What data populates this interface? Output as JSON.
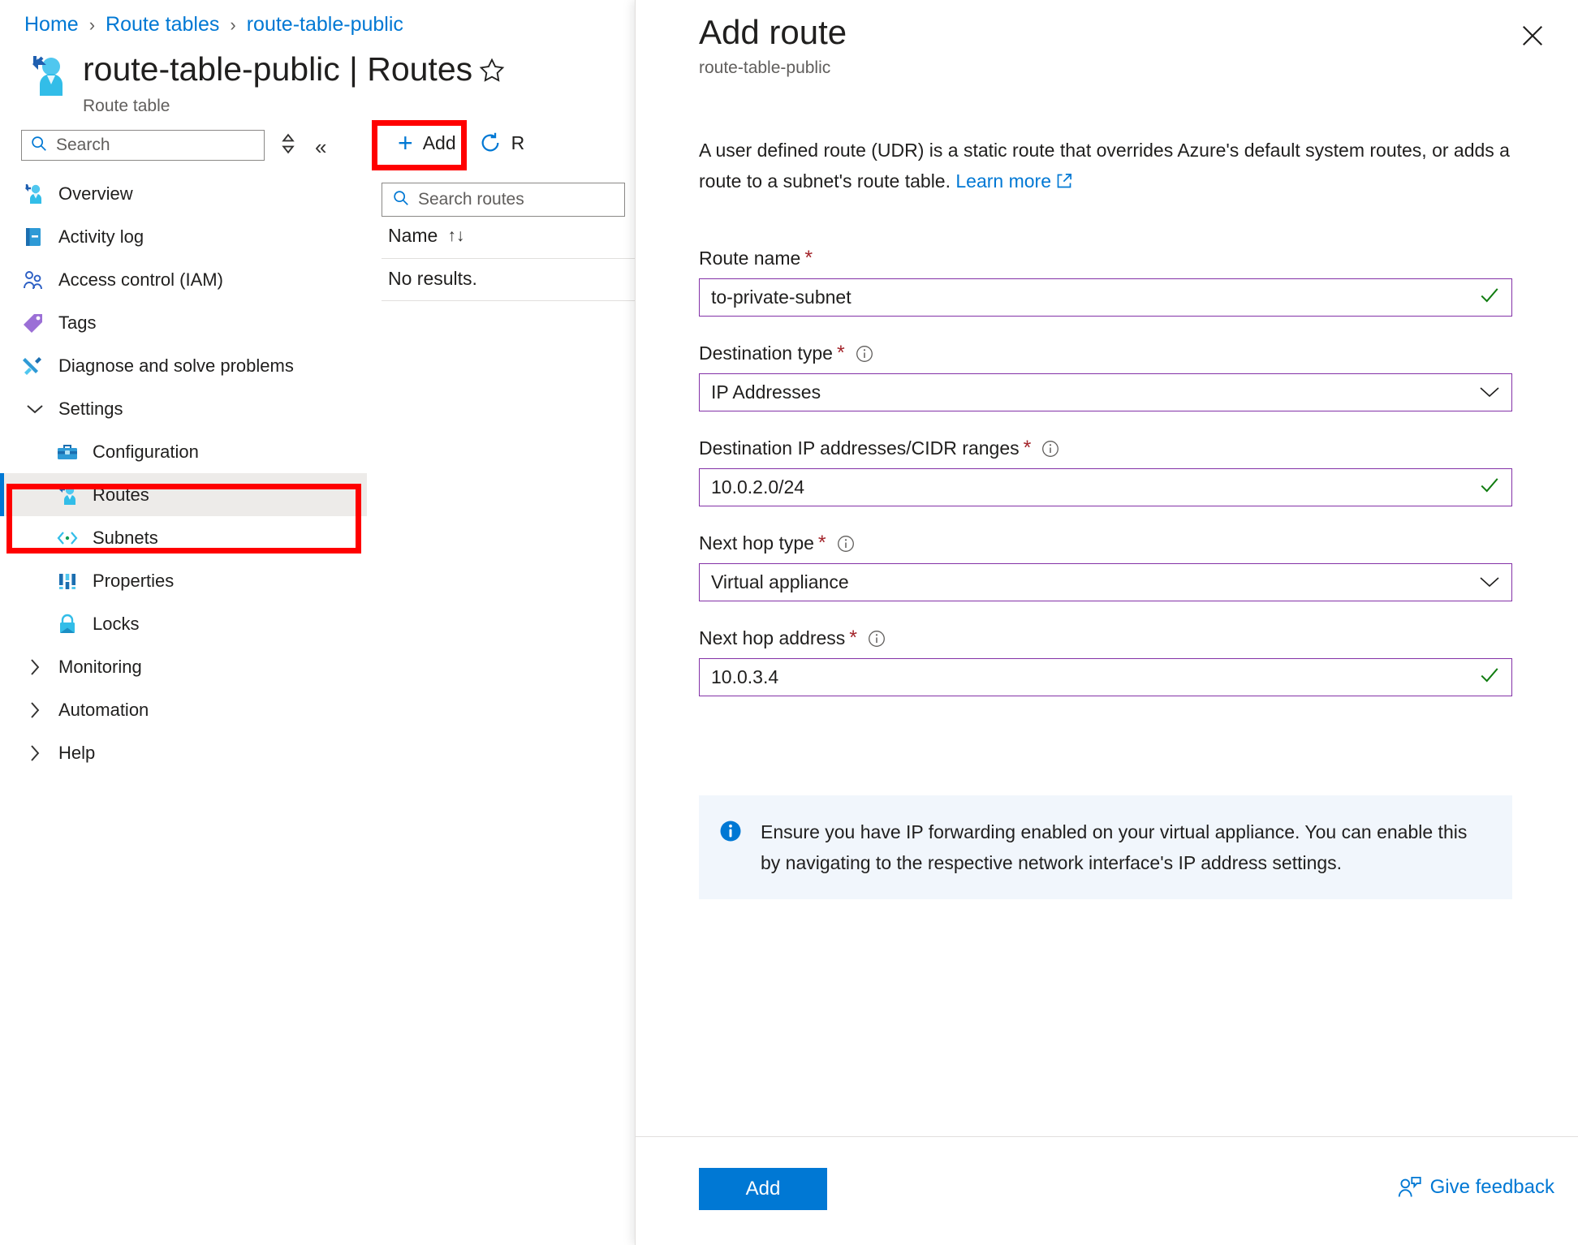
{
  "breadcrumb": [
    {
      "label": "Home"
    },
    {
      "label": "Route tables"
    },
    {
      "label": "route-table-public"
    }
  ],
  "header": {
    "title": "route-table-public | Routes",
    "subtitle": "Route table",
    "favorite_icon": "star-icon",
    "resource_icon": "route-table-icon"
  },
  "left_nav": {
    "search_placeholder": "Search",
    "search_icon": "search-icon",
    "sort_toggle_icon": "sort-toggle-icon",
    "collapse_icon": "collapse-chevrons-icon",
    "items": [
      {
        "label": "Overview",
        "icon": "route-table-icon",
        "level": "top",
        "selected": false,
        "expandable": false
      },
      {
        "label": "Activity log",
        "icon": "activity-log-icon",
        "level": "top",
        "selected": false,
        "expandable": false
      },
      {
        "label": "Access control (IAM)",
        "icon": "iam-people-icon",
        "level": "top",
        "selected": false,
        "expandable": false
      },
      {
        "label": "Tags",
        "icon": "tag-icon",
        "level": "top",
        "selected": false,
        "expandable": false
      },
      {
        "label": "Diagnose and solve problems",
        "icon": "wrench-icon",
        "level": "top",
        "selected": false,
        "expandable": false
      },
      {
        "label": "Settings",
        "icon": "chevron-down-icon",
        "level": "group",
        "selected": false,
        "expandable": true,
        "expanded": true
      },
      {
        "label": "Configuration",
        "icon": "toolbox-icon",
        "level": "sub",
        "selected": false,
        "expandable": false
      },
      {
        "label": "Routes",
        "icon": "route-table-icon",
        "level": "sub",
        "selected": true,
        "expandable": false
      },
      {
        "label": "Subnets",
        "icon": "subnets-icon",
        "level": "sub",
        "selected": false,
        "expandable": false
      },
      {
        "label": "Properties",
        "icon": "properties-icon",
        "level": "sub",
        "selected": false,
        "expandable": false
      },
      {
        "label": "Locks",
        "icon": "lock-icon",
        "level": "sub",
        "selected": false,
        "expandable": false
      },
      {
        "label": "Monitoring",
        "icon": "chevron-right-icon",
        "level": "group",
        "selected": false,
        "expandable": true,
        "expanded": false
      },
      {
        "label": "Automation",
        "icon": "chevron-right-icon",
        "level": "group",
        "selected": false,
        "expandable": true,
        "expanded": false
      },
      {
        "label": "Help",
        "icon": "chevron-right-icon",
        "level": "group",
        "selected": false,
        "expandable": true,
        "expanded": false
      }
    ]
  },
  "toolbar": {
    "add_label": "Add",
    "add_icon": "plus-icon",
    "refresh_label": "R",
    "refresh_icon": "refresh-icon"
  },
  "routes_list": {
    "search_placeholder": "Search routes",
    "search_icon": "search-icon",
    "column_name": "Name",
    "sort_icon": "sort-arrows-icon",
    "empty_text": "No results."
  },
  "annotations": {
    "highlight_color": "#ff0000",
    "boxes": [
      "settings-routes-group",
      "add-button"
    ]
  },
  "panel": {
    "title": "Add route",
    "subtitle": "route-table-public",
    "close_icon": "close-icon",
    "description_text": "A user defined route (UDR) is a static route that overrides Azure's default system routes, or adds a route to a subnet's route table. ",
    "learn_more_label": "Learn more",
    "learn_more_icon": "external-link-icon",
    "fields": [
      {
        "label": "Route name",
        "required": true,
        "has_info": false,
        "info_icon": "info-icon",
        "type": "text",
        "value": "to-private-subnet",
        "status_icon": "valid-check-icon"
      },
      {
        "label": "Destination type",
        "required": true,
        "has_info": true,
        "info_icon": "info-icon",
        "type": "select",
        "value": "IP Addresses",
        "status_icon": "chevron-down-icon"
      },
      {
        "label": "Destination IP addresses/CIDR ranges",
        "required": true,
        "has_info": true,
        "info_icon": "info-icon",
        "type": "text",
        "value": "10.0.2.0/24",
        "status_icon": "valid-check-icon"
      },
      {
        "label": "Next hop type",
        "required": true,
        "has_info": true,
        "info_icon": "info-icon",
        "type": "select",
        "value": "Virtual appliance",
        "status_icon": "chevron-down-icon"
      },
      {
        "label": "Next hop address",
        "required": true,
        "has_info": true,
        "info_icon": "info-icon",
        "type": "text",
        "value": "10.0.3.4",
        "status_icon": "valid-check-icon"
      }
    ],
    "info_banner": {
      "icon": "info-filled-icon",
      "text": "Ensure you have IP forwarding enabled on your virtual appliance. You can enable this by navigating to the respective network interface's IP address settings."
    },
    "footer": {
      "submit_label": "Add",
      "feedback_label": "Give feedback",
      "feedback_icon": "feedback-person-icon"
    }
  },
  "colors": {
    "accent_blue": "#0078d4",
    "field_border_purple": "#8331a7",
    "valid_green": "#107c10",
    "required_red": "#a4262c",
    "annotation_red": "#ff0000",
    "info_bg": "#f1f6fc",
    "selected_bg": "#edebe9"
  }
}
